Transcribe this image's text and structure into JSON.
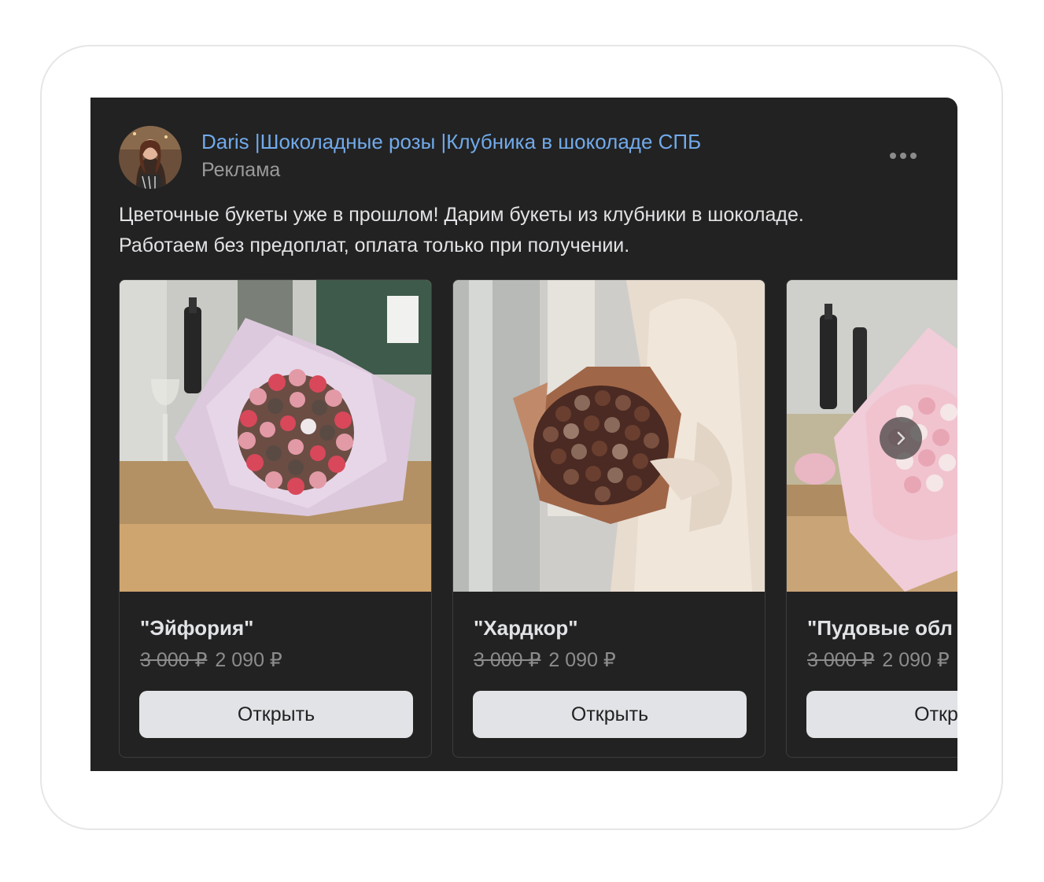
{
  "post": {
    "author": "Daris |Шоколадные розы |Клубника в шоколаде СПБ",
    "label": "Реклама",
    "text_line1": "Цветочные букеты уже в прошлом! Дарим букеты из клубники в шоколаде.",
    "text_line2": "Работаем без предоплат, оплата только при получении."
  },
  "colors": {
    "background": "#222222",
    "author_link": "#71aaeb",
    "button": "#e1e3e6"
  },
  "products": [
    {
      "title": "\"Эйфория\"",
      "old_price": "3 000 ₽",
      "price": "2 090 ₽",
      "button": "Открыть"
    },
    {
      "title": "\"Хардкор\"",
      "old_price": "3 000 ₽",
      "price": "2 090 ₽",
      "button": "Открыть"
    },
    {
      "title": "\"Пудовые обл",
      "old_price": "3 000 ₽",
      "price": "2 090 ₽",
      "button": "Откры"
    }
  ],
  "icons": {
    "more": "more-horizontal-icon",
    "next": "chevron-right-icon"
  }
}
